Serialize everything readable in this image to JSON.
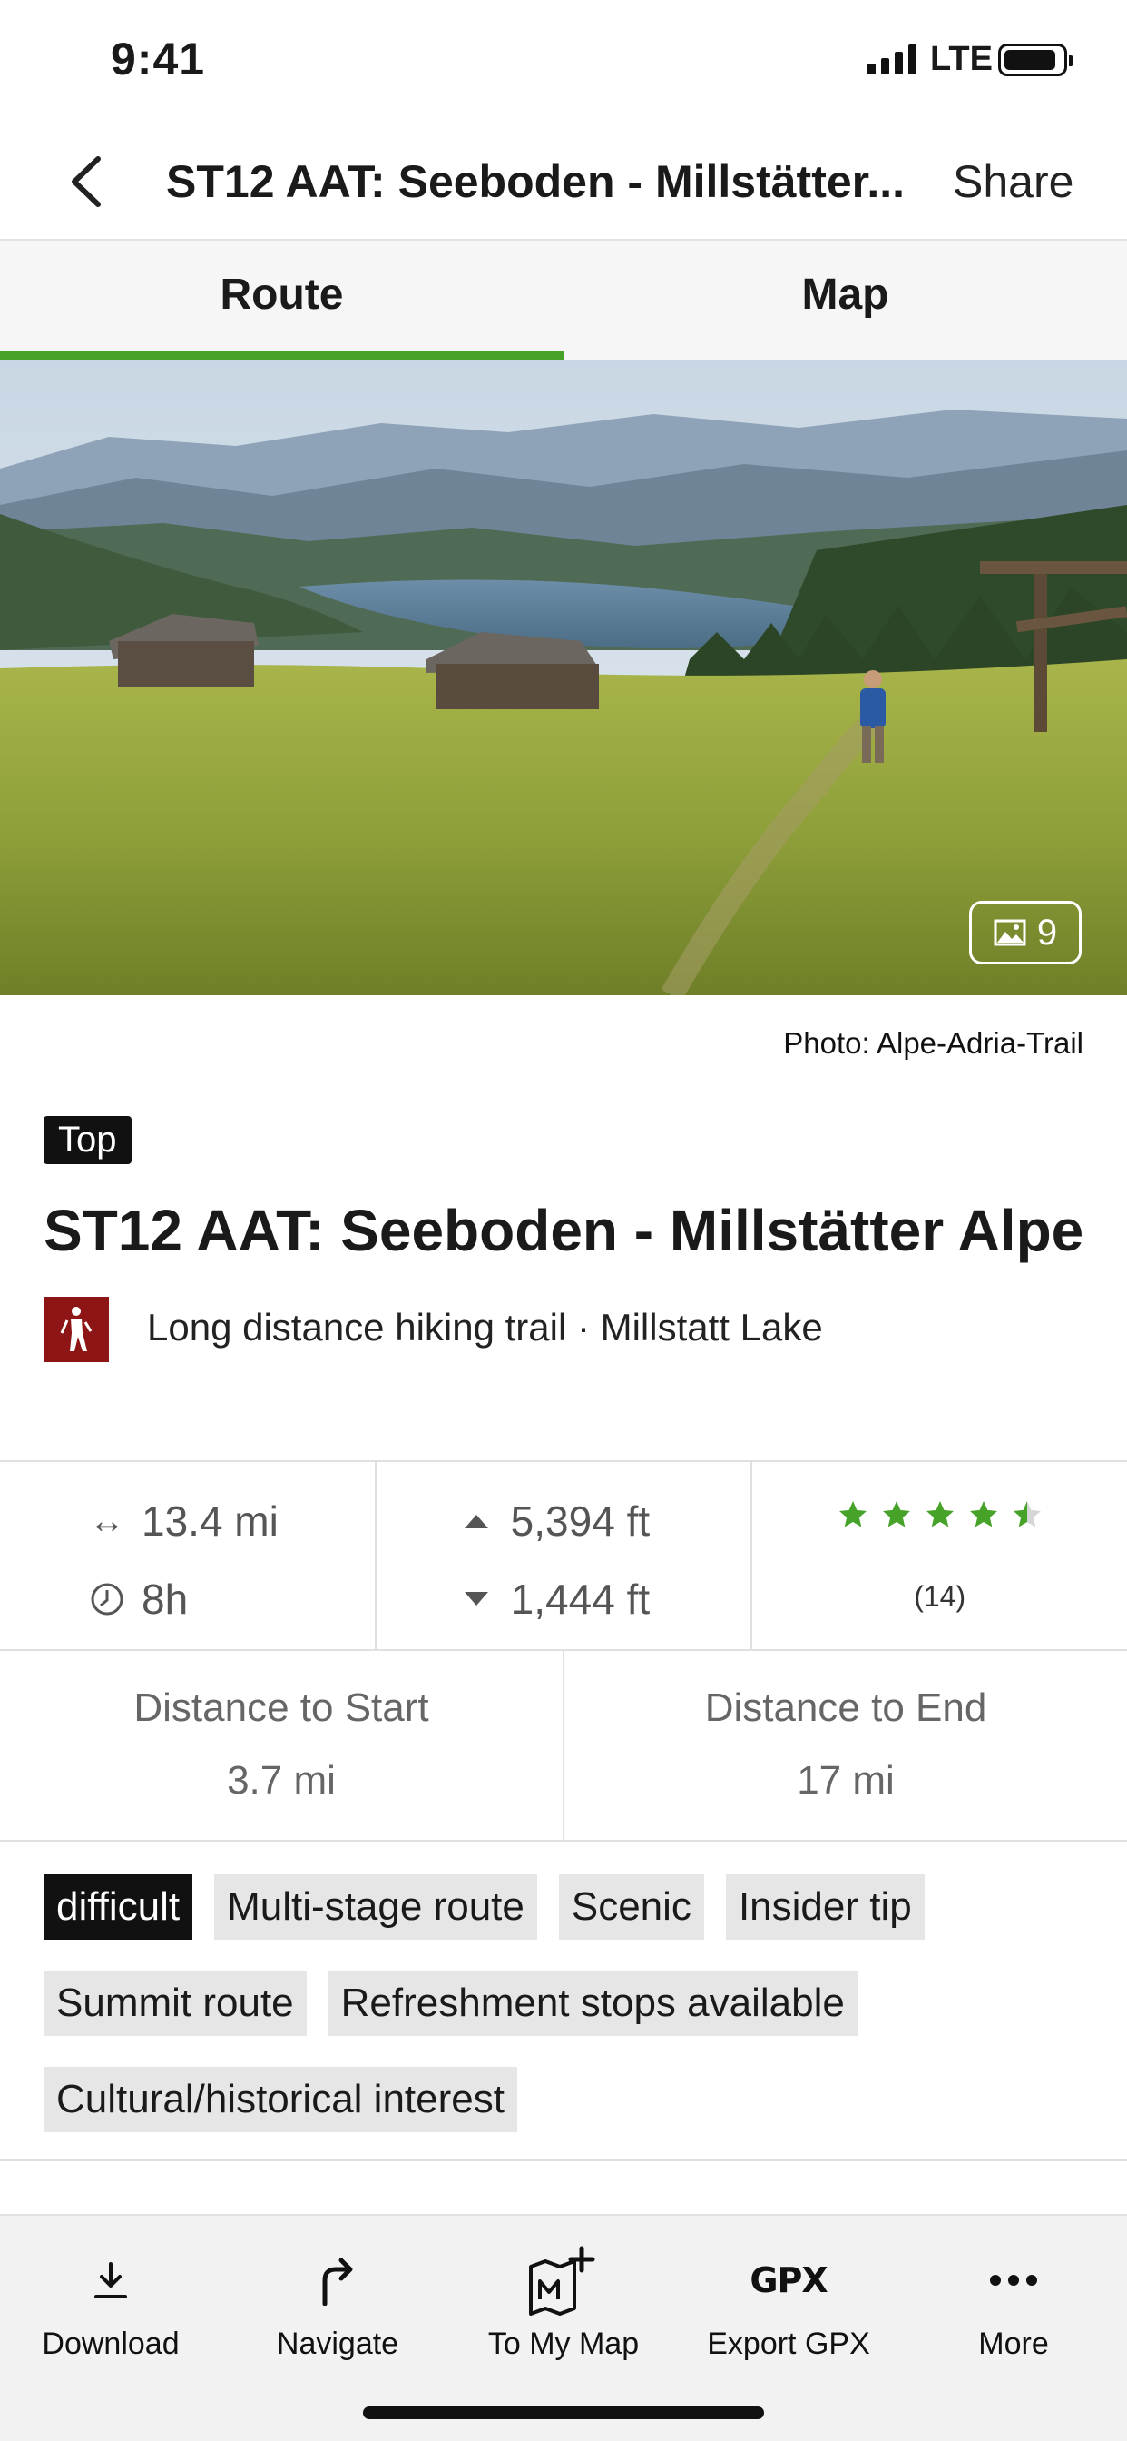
{
  "status_bar": {
    "time": "9:41",
    "network": "LTE"
  },
  "nav": {
    "title": "ST12 AAT: Seeboden - Millstätter...",
    "share_label": "Share"
  },
  "tabs": [
    {
      "label": "Route",
      "active": true
    },
    {
      "label": "Map",
      "active": false
    }
  ],
  "hero": {
    "photo_count": "9",
    "credit": "Photo: Alpe-Adria-Trail"
  },
  "route": {
    "badge": "Top",
    "title": "ST12 AAT: Seeboden - Millstätter Alpe",
    "category": "Long distance hiking trail · Millstatt Lake",
    "category_icon": "hiker-icon"
  },
  "stats": {
    "distance": "13.4 mi",
    "duration": "8h",
    "ascent": "5,394 ft",
    "descent": "1,444 ft",
    "rating": 4.5,
    "rating_count": "(14)"
  },
  "distances": {
    "start_label": "Distance to Start",
    "start_value": "3.7 mi",
    "end_label": "Distance to End",
    "end_value": "17 mi"
  },
  "tags": [
    {
      "label": "difficult",
      "dark": true
    },
    {
      "label": "Multi-stage route",
      "dark": false
    },
    {
      "label": "Scenic",
      "dark": false
    },
    {
      "label": "Insider tip",
      "dark": false
    },
    {
      "label": "Summit route",
      "dark": false
    },
    {
      "label": "Refreshment stops available",
      "dark": false
    },
    {
      "label": "Cultural/historical interest",
      "dark": false
    }
  ],
  "toolbar": {
    "download": "Download",
    "navigate": "Navigate",
    "to_my_map": "To My Map",
    "export_gpx": "Export GPX",
    "gpx_icon_text": "GPX",
    "more": "More"
  },
  "colors": {
    "accent": "#47a22a",
    "category": "#8e1516",
    "star": "#47a22a"
  }
}
